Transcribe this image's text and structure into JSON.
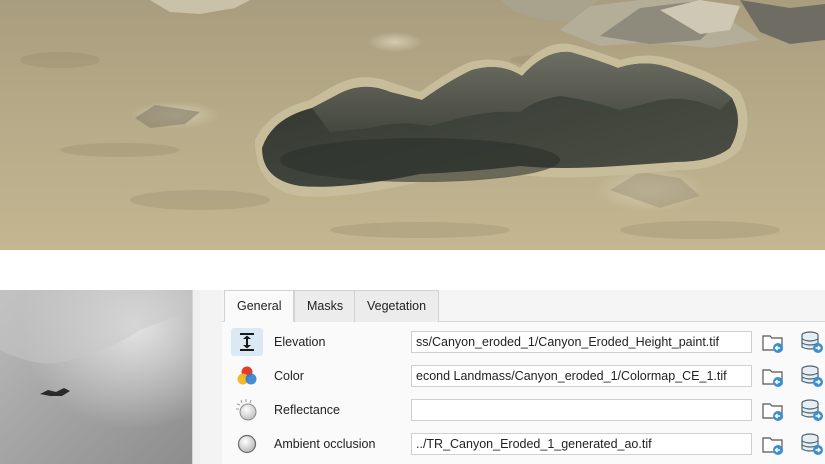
{
  "tabs": [
    {
      "label": "General",
      "active": true
    },
    {
      "label": "Masks",
      "active": false
    },
    {
      "label": "Vegetation",
      "active": false
    }
  ],
  "layers": [
    {
      "label": "Elevation",
      "icon": "elevation-icon",
      "value": "ss/Canyon_eroded_1/Canyon_Eroded_Height_paint.tif",
      "selected": true
    },
    {
      "label": "Color",
      "icon": "color-icon",
      "value": "econd Landmass/Canyon_eroded_1/Colormap_CE_1.tif",
      "selected": false
    },
    {
      "label": "Reflectance",
      "icon": "reflectance-icon",
      "value": "",
      "selected": false
    },
    {
      "label": "Ambient occlusion",
      "icon": "ambient-occlusion-icon",
      "value": "../TR_Canyon_Eroded_1_generated_ao.tif",
      "selected": false
    }
  ],
  "colors": {
    "sand": "#b9ad8a",
    "rock": "#3b3f38",
    "accent": "#3a8fd0",
    "panel": "#f5f5f5"
  }
}
